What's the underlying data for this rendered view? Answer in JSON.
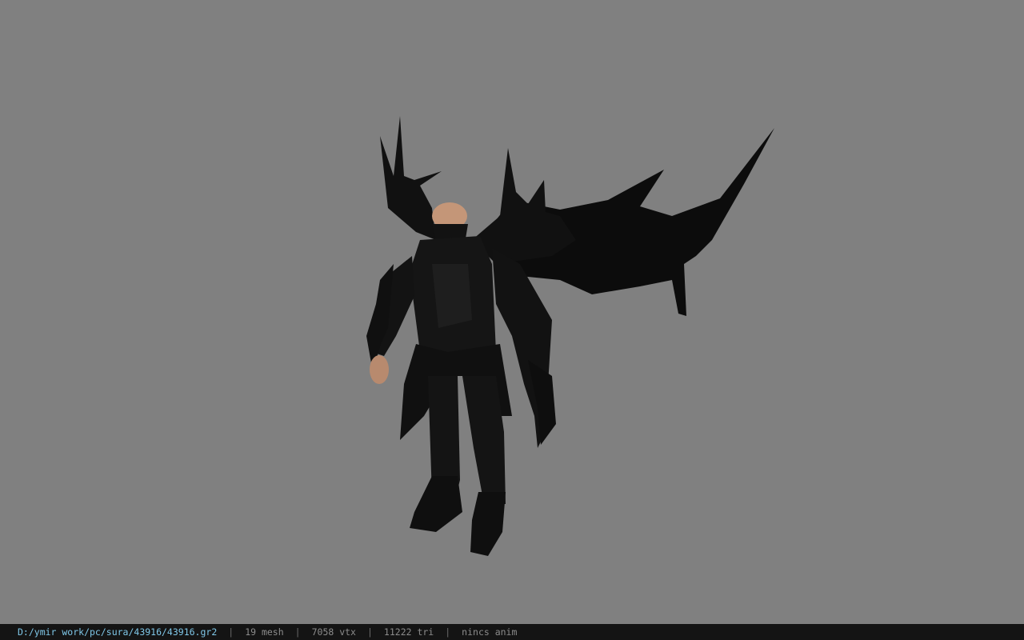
{
  "viewer": {
    "background_color": "#808080",
    "model_icon": "character-model-sura-armor"
  },
  "status_bar": {
    "file_path": "D:/ymir work/pc/sura/43916/43916.gr2",
    "separator": "|",
    "mesh_count": "19 mesh",
    "vertex_count": "7058 vtx",
    "triangle_count": "11222 tri",
    "anim_status": "nincs anim"
  }
}
